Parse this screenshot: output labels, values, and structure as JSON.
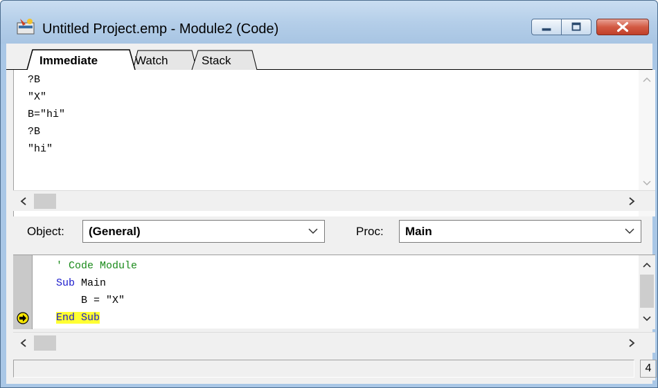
{
  "window": {
    "title": "Untitled Project.emp - Module2 (Code)"
  },
  "tabs": [
    {
      "label": "Immediate",
      "active": true
    },
    {
      "label": "Watch",
      "active": false
    },
    {
      "label": "Stack",
      "active": false
    }
  ],
  "immediate": {
    "lines": [
      "?B",
      "\"X\"",
      "B=\"hi\"",
      "?B",
      "\"hi\""
    ]
  },
  "selectors": {
    "object_label": "Object:",
    "object_value": "(General)",
    "proc_label": "Proc:",
    "proc_value": "Main"
  },
  "code": {
    "lines": [
      {
        "text": "' Code Module",
        "kind": "comment"
      },
      {
        "text": "Sub Main",
        "kind": "sub"
      },
      {
        "text": "    B = \"X\"",
        "kind": "normal"
      },
      {
        "text": "End Sub",
        "kind": "current"
      }
    ]
  },
  "status": {
    "line_number": "4"
  },
  "icons": [
    "app-icon",
    "minimize-icon",
    "maximize-icon",
    "close-icon",
    "scroll-up-icon",
    "scroll-down-icon",
    "scroll-left-icon",
    "scroll-right-icon",
    "chevron-down-icon",
    "execution-pointer-icon"
  ],
  "colors": {
    "keyword": "#1a1acc",
    "comment": "#1a8a1a",
    "current_line_highlight": "#ffff33"
  }
}
